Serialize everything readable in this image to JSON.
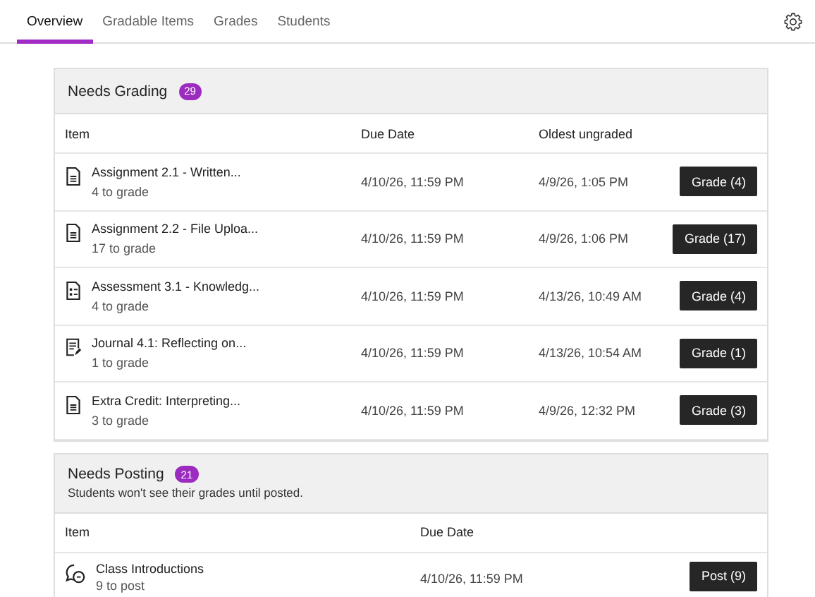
{
  "tabs": [
    {
      "label": "Overview",
      "selected": true
    },
    {
      "label": "Gradable Items",
      "selected": false
    },
    {
      "label": "Grades",
      "selected": false
    },
    {
      "label": "Students",
      "selected": false
    }
  ],
  "needs_grading": {
    "title": "Needs Grading",
    "count": "29",
    "columns": [
      "Item",
      "Due Date",
      "Oldest ungraded"
    ],
    "rows": [
      {
        "kind": "document",
        "title": "Assignment 2.1 - Written...",
        "subtitle": "4 to grade",
        "due": "4/10/26, 11:59 PM",
        "oldest": "4/9/26, 1:05 PM",
        "action": "Grade (4)"
      },
      {
        "kind": "document",
        "title": "Assignment 2.2 - File Uploa...",
        "subtitle": "17 to grade",
        "due": "4/10/26, 11:59 PM",
        "oldest": "4/9/26, 1:06 PM",
        "action": "Grade (17)"
      },
      {
        "kind": "test",
        "title": "Assessment 3.1 - Knowledg...",
        "subtitle": "4 to grade",
        "due": "4/10/26, 11:59 PM",
        "oldest": "4/13/26, 10:49 AM",
        "action": "Grade (4)"
      },
      {
        "kind": "journal",
        "title": "Journal 4.1: Reflecting on...",
        "subtitle": "1 to grade",
        "due": "4/10/26, 11:59 PM",
        "oldest": "4/13/26, 10:54 AM",
        "action": "Grade (1)"
      },
      {
        "kind": "document",
        "title": "Extra Credit: Interpreting...",
        "subtitle": "3 to grade",
        "due": "4/10/26, 11:59 PM",
        "oldest": "4/9/26, 12:32 PM",
        "action": "Grade (3)"
      }
    ]
  },
  "needs_posting": {
    "title": "Needs Posting",
    "count": "21",
    "note": "Students won't see their grades until posted.",
    "columns": [
      "Item",
      "Due Date"
    ],
    "rows": [
      {
        "kind": "discussion",
        "title": "Class Introductions",
        "subtitle": "9 to post",
        "due": "4/10/26, 11:59 PM",
        "action": "Post (9)"
      }
    ]
  }
}
